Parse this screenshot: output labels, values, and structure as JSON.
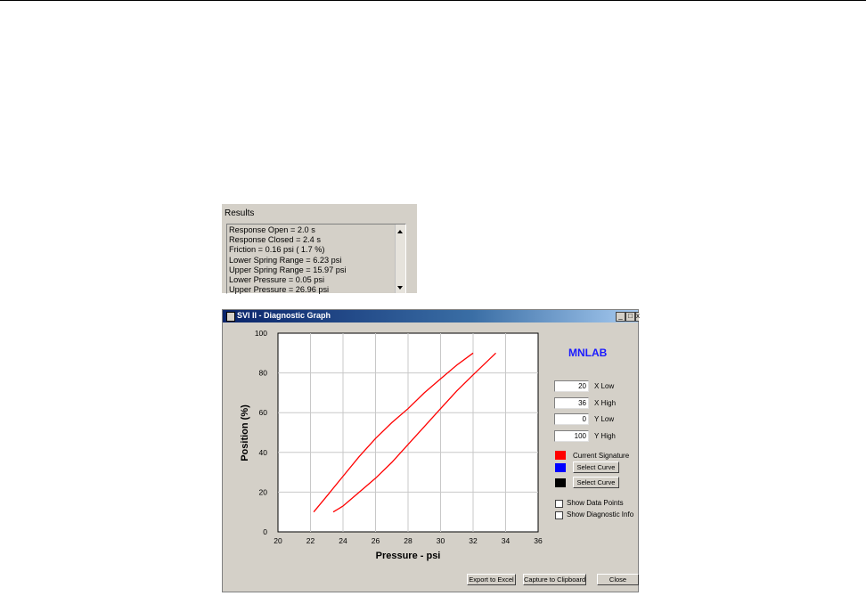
{
  "results": {
    "title": "Results",
    "lines": [
      "Response Open =  2.0 s",
      "Response Closed =  2.4 s",
      "Friction =  0.16 psi (  1.7 %)",
      "Lower Spring Range =   6.23 psi",
      "Upper Spring Range =  15.97 psi",
      "Lower Pressure =   0.05 psi",
      "Upper Pressure =  26.96 psi"
    ]
  },
  "window": {
    "title": "SVI II - Diagnostic Graph",
    "brand": "MNLAB",
    "fields": [
      {
        "value": "20",
        "label": "X Low"
      },
      {
        "value": "36",
        "label": "X High"
      },
      {
        "value": "0",
        "label": "Y Low"
      },
      {
        "value": "100",
        "label": "Y High"
      }
    ],
    "legend": {
      "current_signature": "Current Signature",
      "select_curve_1": "Select Curve",
      "select_curve_2": "Select Curve",
      "colors": {
        "current": "#ff0000",
        "curve1": "#0000ff",
        "curve2": "#000000"
      }
    },
    "checkboxes": {
      "show_data_points": "Show Data Points",
      "show_diagnostic_info": "Show Diagnostic Info"
    },
    "buttons": {
      "export": "Export to Excel",
      "capture": "Capture to Clipboard",
      "close": "Close"
    }
  },
  "chart_data": {
    "type": "line",
    "xlabel": "Pressure - psi",
    "ylabel": "Position (%)",
    "xlim": [
      20,
      36
    ],
    "ylim": [
      0,
      100
    ],
    "xticks": [
      20,
      22,
      24,
      26,
      28,
      30,
      32,
      34,
      36
    ],
    "yticks": [
      0,
      20,
      40,
      60,
      80,
      100
    ],
    "grid": true,
    "series": [
      {
        "color": "#ff0000",
        "x": [
          22.2,
          23.0,
          24.0,
          25.0,
          26.0,
          27.0,
          28.0,
          29.0,
          30.0,
          31.0,
          32.0
        ],
        "y": [
          10,
          18,
          28,
          38,
          47,
          55,
          62,
          70,
          77,
          84,
          90
        ]
      },
      {
        "color": "#ff0000",
        "x": [
          23.4,
          24.0,
          25.0,
          26.0,
          27.0,
          28.0,
          29.0,
          30.0,
          31.0,
          32.0,
          33.4
        ],
        "y": [
          10,
          13,
          20,
          27,
          35,
          44,
          53,
          62,
          71,
          79,
          90
        ]
      }
    ]
  }
}
